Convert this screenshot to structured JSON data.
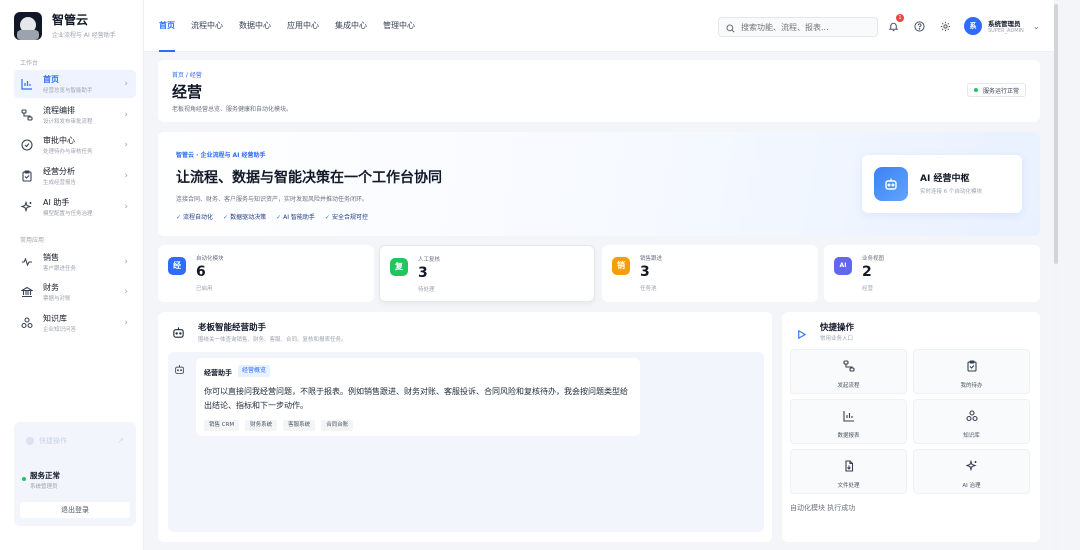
{
  "brand": {
    "name": "智管云",
    "subtitle": "企业流程与 AI 经营助手"
  },
  "sidebar": {
    "section_workspace": "工作台",
    "section_common": "常用应用",
    "items": [
      {
        "title": "首页",
        "sub": "经营总览与智能助手",
        "icon": "chart-bar-icon",
        "active": true
      },
      {
        "title": "流程编排",
        "sub": "设计和发布审批流程",
        "icon": "flow-icon"
      },
      {
        "title": "审批中心",
        "sub": "处理待办与审核任务",
        "icon": "check-circle-icon"
      },
      {
        "title": "经营分析",
        "sub": "生成经营报告",
        "icon": "clipboard-icon"
      },
      {
        "title": "AI 助手",
        "sub": "模型配置与任务治理",
        "icon": "sparkle-icon"
      },
      {
        "title": "销售",
        "sub": "客户跟进任务",
        "icon": "pulse-icon"
      },
      {
        "title": "财务",
        "sub": "票据与对账",
        "icon": "bank-icon"
      },
      {
        "title": "知识库",
        "sub": "企业知识问答",
        "icon": "nodes-icon"
      }
    ],
    "status_card": {
      "faded_label": "快捷操作",
      "title": "服务正常",
      "subtitle": "系统管理员",
      "logout": "退出登录"
    }
  },
  "topbar": {
    "tabs": [
      "首页",
      "流程中心",
      "数据中心",
      "应用中心",
      "集成中心",
      "管理中心"
    ],
    "search_placeholder": "搜索功能、流程、报表...",
    "notification_count": "1",
    "user": {
      "avatar": "系",
      "name": "系统管理员",
      "role": "SUPER_ADMIN"
    }
  },
  "page": {
    "breadcrumb": "首页 / 经营",
    "title": "经营",
    "description": "老板视角经营总览、服务健康和自动化模块。",
    "service_status": "服务运行正常"
  },
  "hero": {
    "tag": "智管云 · 企业流程与 AI 经营助手",
    "title": "让流程、数据与智能决策在一个工作台协同",
    "description": "连接合同、财务、客户服务与知识资产，实时发现风险并推动任务闭环。",
    "features": [
      "流程自动化",
      "数据驱动决策",
      "AI 智能助手",
      "安全合规可控"
    ],
    "ai_card": {
      "title": "AI 经营中枢",
      "subtitle": "实时连接 6 个自动化模块"
    }
  },
  "stats": [
    {
      "icon_text": "经",
      "color": "#2f6bff",
      "label": "自动化模块",
      "value": "6",
      "note": "已启用"
    },
    {
      "icon_text": "复",
      "color": "#22c55e",
      "label": "人工复核",
      "value": "3",
      "note": "待处理"
    },
    {
      "icon_text": "销",
      "color": "#f59e0b",
      "label": "销售跟进",
      "value": "3",
      "note": "任务池"
    },
    {
      "icon_text": "AI",
      "color": "#6366f1",
      "label": "业务视图",
      "value": "2",
      "note": "经营"
    }
  ],
  "assistant": {
    "title": "老板智能经营助手",
    "subtitle": "围绕关一体查询销售、财务、客服、合同、复核和报表任务。",
    "message": {
      "sender": "经营助手",
      "tag": "经营概览",
      "text": "你可以直接问我经营问题，不限于报表。例如销售跟进、财务对账、客服投诉、合同风险和复核待办，我会按问题类型给出结论、指标和下一步动作。",
      "chips": [
        "销售 CRM",
        "财务系统",
        "客服系统",
        "合同台账"
      ]
    }
  },
  "quick_actions": {
    "title": "快捷操作",
    "subtitle": "常用业务入口",
    "items": [
      {
        "label": "发起流程",
        "icon": "flow-icon"
      },
      {
        "label": "我的待办",
        "icon": "clipboard-check-icon"
      },
      {
        "label": "数据报表",
        "icon": "chart-bar-icon"
      },
      {
        "label": "知识库",
        "icon": "nodes-icon"
      },
      {
        "label": "文件处理",
        "icon": "file-icon"
      },
      {
        "label": "AI 治理",
        "icon": "sparkle-icon"
      }
    ],
    "footer": "自动化模块 执行成功"
  }
}
